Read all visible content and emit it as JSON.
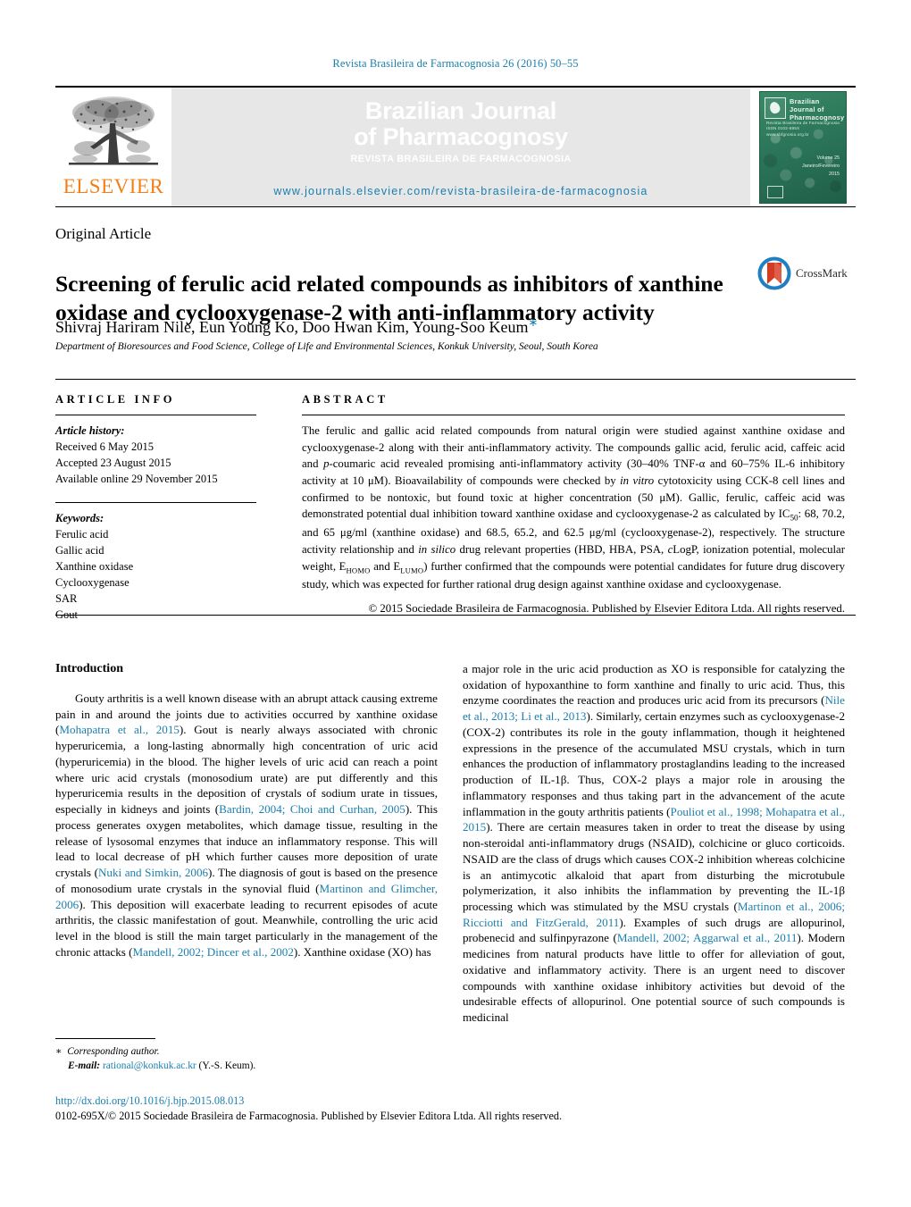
{
  "running_head": "Revista Brasileira de Farmacognosia 26 (2016) 50–55",
  "masthead": {
    "publisher_name": "ELSEVIER",
    "banner_title_line1": "Brazilian Journal",
    "banner_title_line2": "of Pharmacognosy",
    "banner_subtitle": "REVISTA BRASILEIRA DE FARMACOGNOSIA",
    "banner_url": "www.journals.elsevier.com/revista-brasileira-de-farmacognosia",
    "cover": {
      "title_line1": "Brazilian",
      "title_line2": "Journal of",
      "title_line3": "Pharmacognosy",
      "subtitle_line1": "Revista Brasileira de Farmacognosia",
      "subtitle_line2": "ISSN 0102-695X   www.sbfgnosia.org.br",
      "volume_line1": "Volume 25",
      "volume_line2": "Janeiro/Fevereiro",
      "volume_line3": "2015"
    }
  },
  "article": {
    "type": "Original Article",
    "title": "Screening of ferulic acid related compounds as inhibitors of xanthine oxidase and cyclooxygenase-2 with anti-inflammatory activity",
    "authors": "Shivraj Hariram Nile,  Eun Young Ko,  Doo Hwan Kim, Young-Soo Keum",
    "corresponding_marker": "∗",
    "affiliation": "Department of Bioresources and Food Science, College of Life and Environmental Sciences, Konkuk University, Seoul, South Korea",
    "crossmark_label": "CrossMark"
  },
  "article_info": {
    "heading": "ARTICLE INFO",
    "history_label": "Article history:",
    "history": [
      "Received 6 May 2015",
      "Accepted 23 August 2015",
      "Available online 29 November 2015"
    ],
    "keywords_label": "Keywords:",
    "keywords": [
      "Ferulic acid",
      "Gallic acid",
      "Xanthine oxidase",
      "Cyclooxygenase",
      "SAR",
      "Gout"
    ]
  },
  "abstract": {
    "heading": "ABSTRACT",
    "copyright": "© 2015 Sociedade Brasileira de Farmacognosia. Published by Elsevier Editora Ltda. All rights reserved."
  },
  "body": {
    "intro_heading": "Introduction"
  },
  "footer": {
    "corresponding_author": "Corresponding author.",
    "email_label": "E-mail:",
    "email": "rational@konkuk.ac.kr",
    "email_owner": "(Y.-S. Keum).",
    "doi": "http://dx.doi.org/10.1016/j.bjp.2015.08.013",
    "issn_line": "0102-695X/© 2015 Sociedade Brasileira de Farmacognosia. Published by Elsevier Editora Ltda. All rights reserved."
  },
  "colors": {
    "link": "#1a7fae",
    "elsevier_orange": "#F08019",
    "cover_green": "#2f7e5c"
  }
}
